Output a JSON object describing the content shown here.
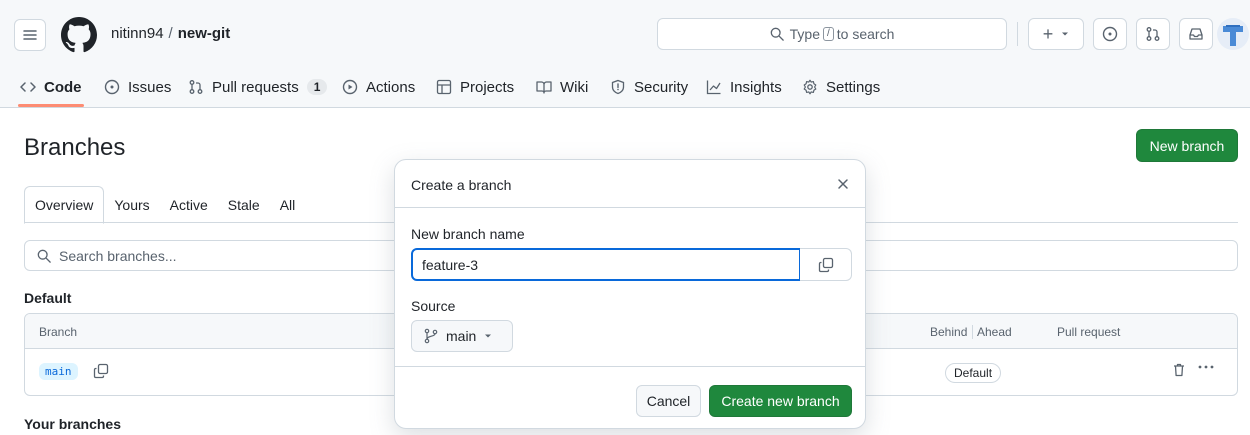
{
  "header": {
    "owner": "nitinn94",
    "separator": "/",
    "repo": "new-git",
    "search_prefix": "Type",
    "search_key": "/",
    "search_suffix": "to search",
    "plus_label": "+"
  },
  "nav": {
    "items": [
      {
        "label": "Code",
        "icon": "code-icon"
      },
      {
        "label": "Issues",
        "icon": "issue-icon"
      },
      {
        "label": "Pull requests",
        "icon": "pull-request-icon",
        "count": "1"
      },
      {
        "label": "Actions",
        "icon": "play-icon"
      },
      {
        "label": "Projects",
        "icon": "table-icon"
      },
      {
        "label": "Wiki",
        "icon": "book-icon"
      },
      {
        "label": "Security",
        "icon": "shield-icon"
      },
      {
        "label": "Insights",
        "icon": "graph-icon"
      },
      {
        "label": "Settings",
        "icon": "gear-icon"
      }
    ],
    "selected": "Code"
  },
  "page": {
    "title": "Branches",
    "new_branch_label": "New branch",
    "tabs": [
      "Overview",
      "Yours",
      "Active",
      "Stale",
      "All"
    ],
    "selected_tab": "Overview",
    "search_placeholder": "Search branches...",
    "default_section": "Default",
    "your_section": "Your branches",
    "table": {
      "col_branch": "Branch",
      "col_behind": "Behind",
      "col_ahead": "Ahead",
      "col_pr": "Pull request",
      "row_branch": "main",
      "row_badge": "Default"
    }
  },
  "modal": {
    "title": "Create a branch",
    "name_label": "New branch name",
    "name_value": "feature-3",
    "source_label": "Source",
    "source_value": "main",
    "cancel_label": "Cancel",
    "create_label": "Create new branch"
  },
  "colors": {
    "primary_green": "#1f883d",
    "focus_blue": "#0969da",
    "nav_underline": "#fd8c73",
    "border": "#d1d9e0"
  }
}
